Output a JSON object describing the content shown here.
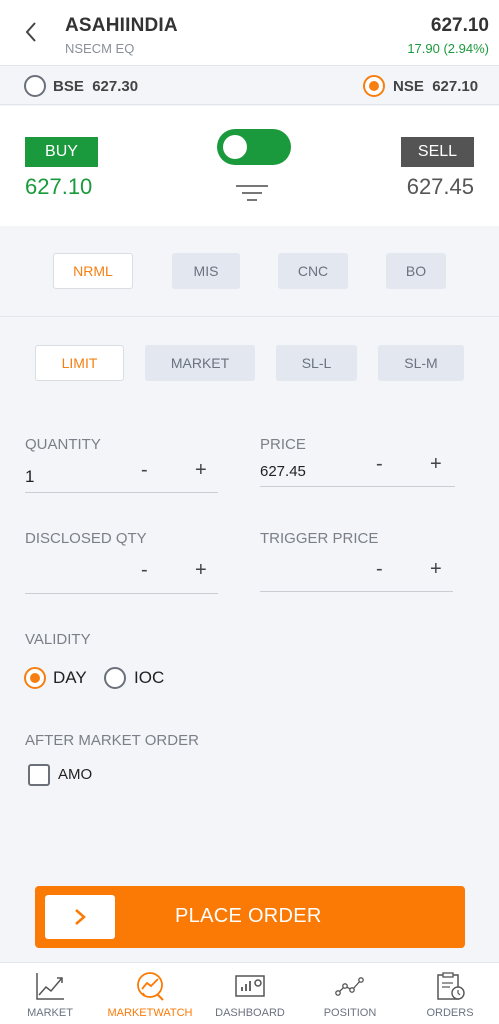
{
  "header": {
    "symbol": "ASAHIINDIA",
    "segment": "NSECM EQ",
    "ltp": "627.10",
    "change": "17.90 (2.94%)"
  },
  "exchanges": [
    {
      "name": "BSE",
      "price": "627.30",
      "selected": false
    },
    {
      "name": "NSE",
      "price": "627.10",
      "selected": true
    }
  ],
  "trade": {
    "buy_label": "BUY",
    "buy_price": "627.10",
    "sell_label": "SELL",
    "sell_price": "627.45",
    "toggle_on": true
  },
  "product_types": [
    {
      "label": "NRML",
      "selected": true
    },
    {
      "label": "MIS",
      "selected": false
    },
    {
      "label": "CNC",
      "selected": false
    },
    {
      "label": "BO",
      "selected": false
    }
  ],
  "order_types": [
    {
      "label": "LIMIT",
      "selected": true
    },
    {
      "label": "MARKET",
      "selected": false
    },
    {
      "label": "SL-L",
      "selected": false
    },
    {
      "label": "SL-M",
      "selected": false
    }
  ],
  "fields": {
    "quantity": {
      "label": "QUANTITY",
      "value": "1",
      "minus": "-",
      "plus": "+"
    },
    "price": {
      "label": "PRICE",
      "value": "627.45",
      "minus": "-",
      "plus": "+"
    },
    "disclosed_qty": {
      "label": "DISCLOSED QTY",
      "value": "",
      "minus": "-",
      "plus": "+"
    },
    "trigger_price": {
      "label": "TRIGGER PRICE",
      "value": "",
      "minus": "-",
      "plus": "+"
    }
  },
  "validity": {
    "label": "VALIDITY",
    "options": [
      {
        "label": "DAY",
        "selected": true
      },
      {
        "label": "IOC",
        "selected": false
      }
    ]
  },
  "amo": {
    "label": "AFTER MARKET ORDER",
    "checkbox_label": "AMO",
    "checked": false
  },
  "place_order": {
    "label": "PLACE ORDER"
  },
  "nav": [
    {
      "label": "MARKET",
      "icon": "chart-line-icon",
      "active": false
    },
    {
      "label": "MARKETWATCH",
      "icon": "marketwatch-icon",
      "active": true
    },
    {
      "label": "DASHBOARD",
      "icon": "dashboard-icon",
      "active": false
    },
    {
      "label": "POSITION",
      "icon": "position-icon",
      "active": false
    },
    {
      "label": "ORDERS",
      "icon": "orders-icon",
      "active": false
    }
  ],
  "colors": {
    "accent": "#fb7a06",
    "buy": "#1a9a3c",
    "sell": "#545454",
    "background": "#f3f5f9"
  }
}
